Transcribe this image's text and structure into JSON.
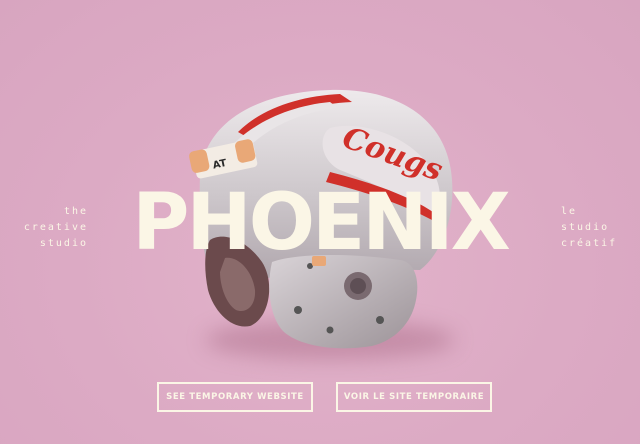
{
  "brand": {
    "title": "PHOENIX"
  },
  "tagline_en": [
    "the",
    "creative",
    "studio"
  ],
  "tagline_fr": [
    "le",
    "studio",
    "créatif"
  ],
  "buttons": {
    "english": "SEE TEMPORARY WEBSITE",
    "french": "VOIR LE SITE TEMPORAIRE"
  },
  "helmet": {
    "decal_text": "Cougs",
    "sticker_text": "AT"
  },
  "colors": {
    "background": "#dcaac4",
    "text": "#fbf6e6",
    "helmet_shell": "#c9c4c8",
    "stripe": "#d0302a"
  }
}
